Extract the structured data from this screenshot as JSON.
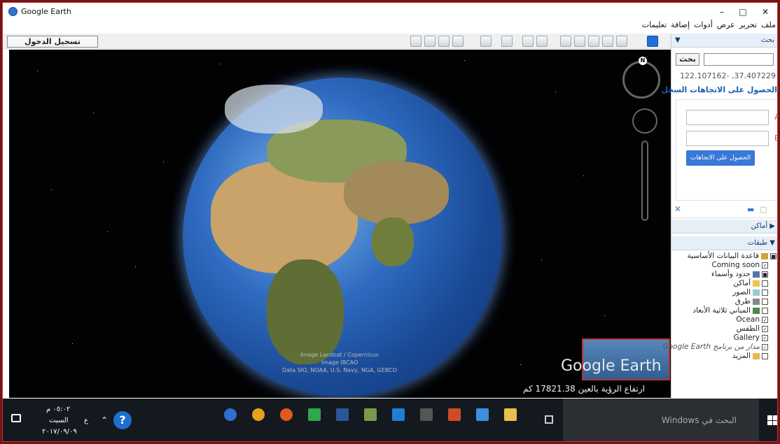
{
  "window": {
    "title": "Google Earth",
    "minimize": "–",
    "maximize": "□",
    "close": "✕"
  },
  "menu": [
    "ملف",
    "تحرير",
    "عرض",
    "أدوات",
    "إضافة",
    "تعليمات"
  ],
  "toolbar": {
    "sign_in_label": "تسجيل الدخول"
  },
  "map": {
    "attribution": [
      "Image Landsat / Copernicus",
      "Image IBCAO",
      "Data SIO, NOAA, U.S. Navy, NGA, GEBCO"
    ],
    "watermark": "Google Earth",
    "altitude_text": "ارتفاع الرؤية بالعين 17821.38 كم",
    "compass_letter": "N"
  },
  "sidebar": {
    "search_header": "بحث",
    "search_button": "بحث",
    "search_value": "",
    "coords": "122.107162- ,37.407229",
    "directions_link": "الحصول على الاتجاهات السجل",
    "field_a_label": "A",
    "field_b_label": "B",
    "directions_button": "الحصول على الاتجاهات",
    "places_header": "أماكن",
    "layers_header": "طبقات",
    "layers": [
      {
        "label": "قاعدة البيانات الأساسية",
        "checked": true
      },
      {
        "label": "Coming soon",
        "checked": true
      },
      {
        "label": "حدود وأسماء",
        "checked": true
      },
      {
        "label": "أماكن",
        "checked": false
      },
      {
        "label": "الصور",
        "checked": false
      },
      {
        "label": "طرق",
        "checked": false
      },
      {
        "label": "المباني ثلاثية الأبعاد",
        "checked": false
      },
      {
        "label": "Ocean",
        "checked": true
      },
      {
        "label": "الطقس",
        "checked": true
      },
      {
        "label": "Gallery",
        "checked": true
      },
      {
        "label": "مدار من برنامج Google Earth",
        "checked": true
      },
      {
        "label": "المزيد",
        "checked": false
      }
    ]
  },
  "taskbar": {
    "search_placeholder": "البحث في Windows",
    "time": "٠٥:٠٢ م",
    "day": "السبت",
    "date": "٢٠١٧/٠٩/٠٩",
    "lang": "ع",
    "help": "?"
  }
}
